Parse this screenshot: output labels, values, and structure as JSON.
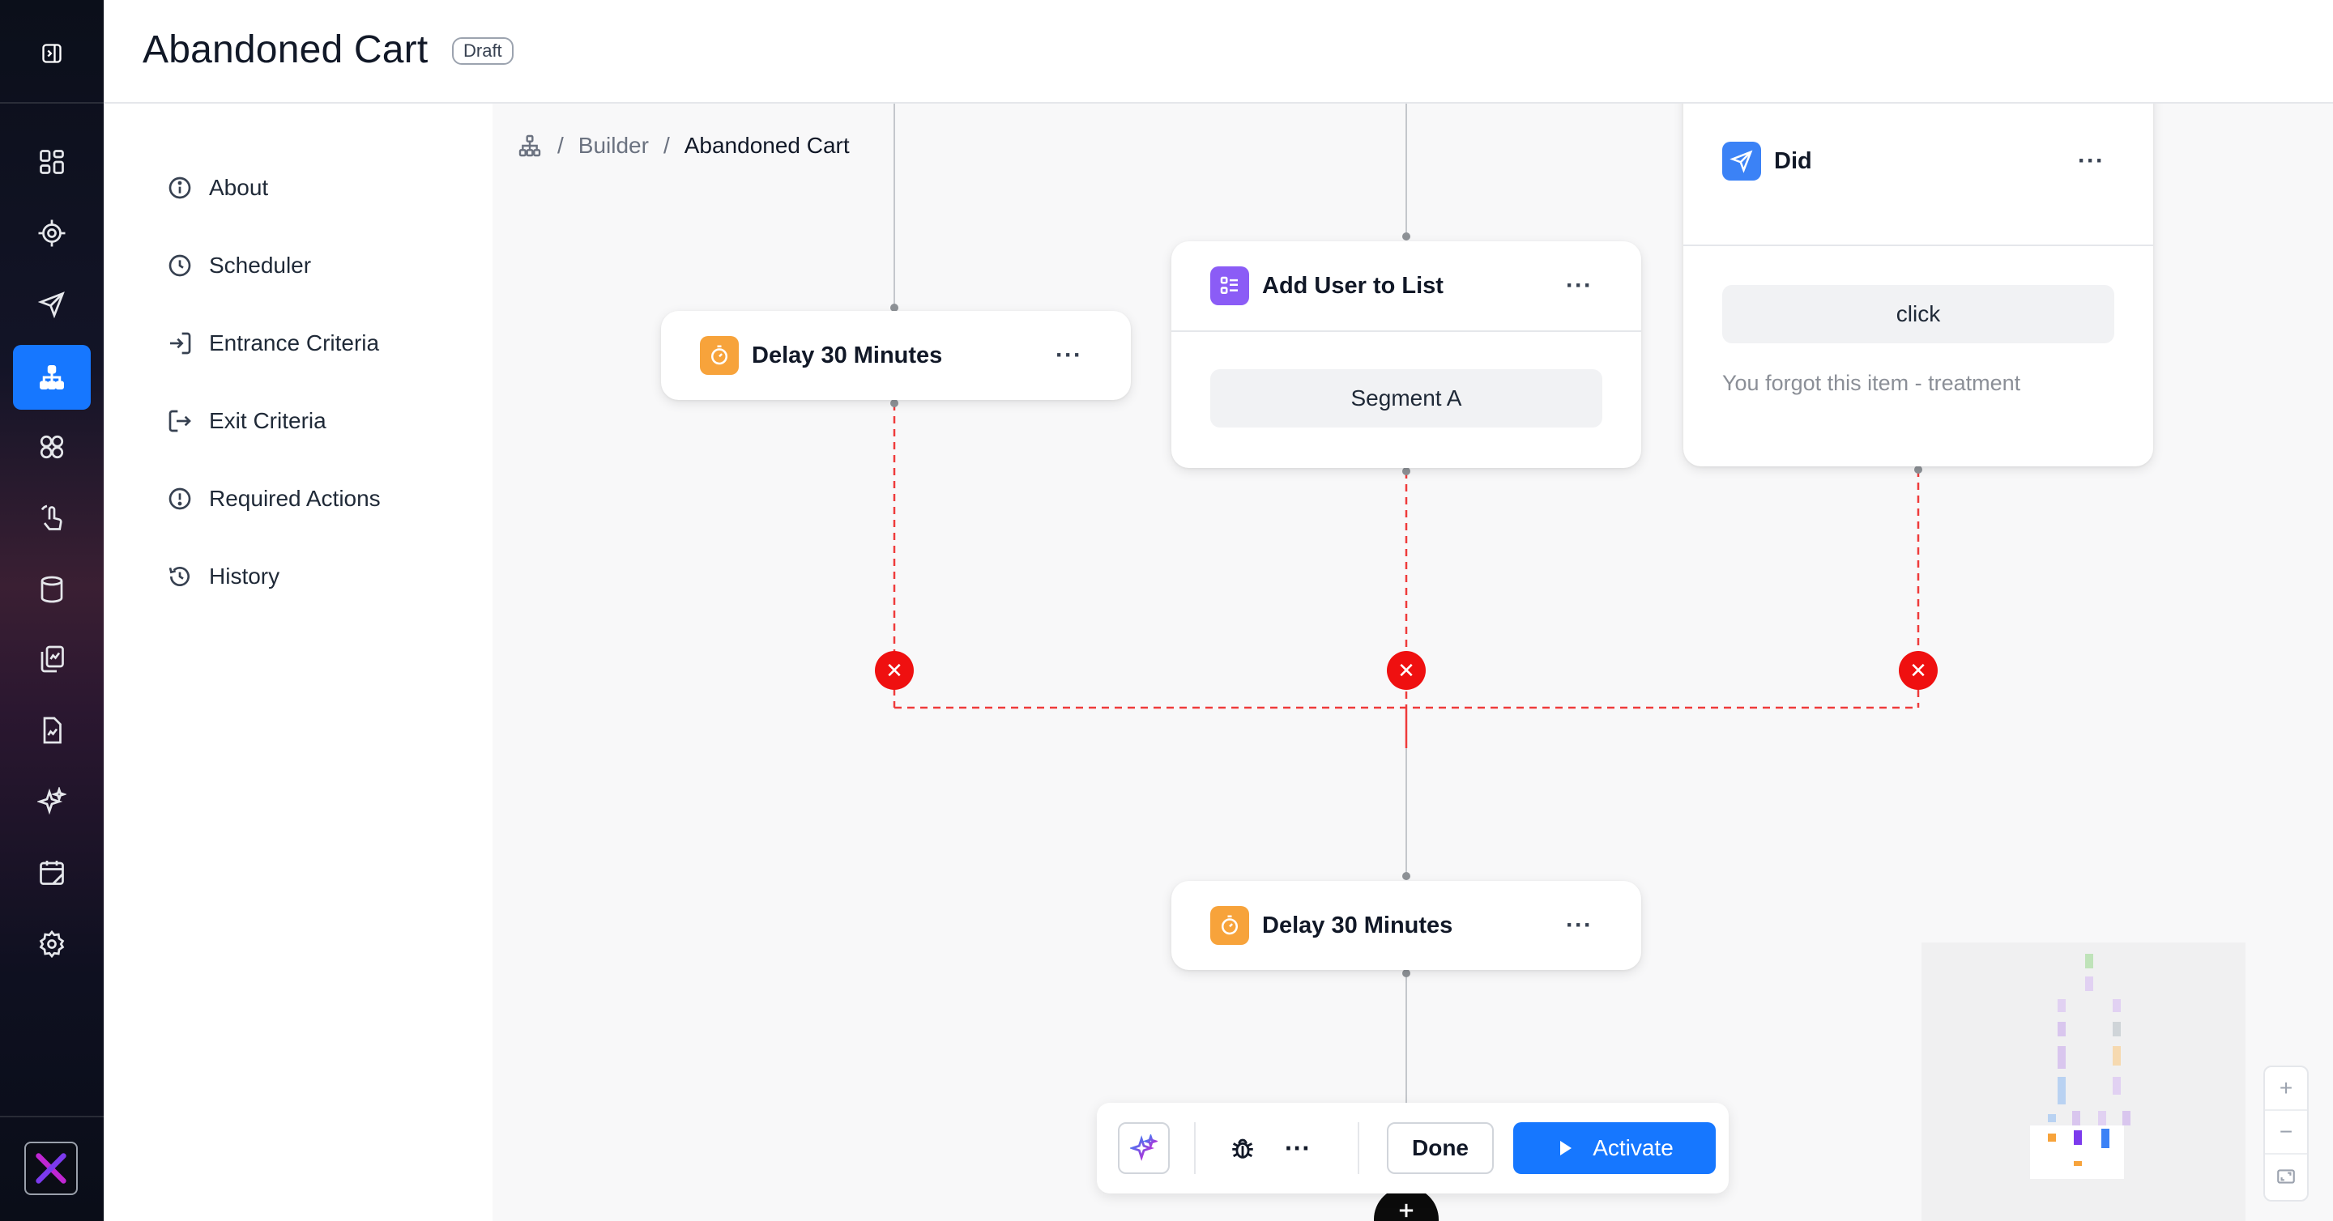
{
  "header": {
    "title": "Abandoned Cart",
    "status_badge": "Draft"
  },
  "rail": {
    "items": [
      {
        "icon": "dashboard-icon"
      },
      {
        "icon": "target-icon"
      },
      {
        "icon": "send-icon"
      },
      {
        "icon": "flow-builder-icon",
        "active": true
      },
      {
        "icon": "segments-icon"
      },
      {
        "icon": "touch-icon"
      },
      {
        "icon": "database-icon"
      },
      {
        "icon": "content-icon"
      },
      {
        "icon": "reports-icon"
      },
      {
        "icon": "ai-sparkle-icon"
      },
      {
        "icon": "calendar-icon"
      },
      {
        "icon": "settings-icon"
      }
    ]
  },
  "subnav": {
    "items": [
      {
        "label": "About",
        "icon": "info-icon"
      },
      {
        "label": "Scheduler",
        "icon": "clock-icon"
      },
      {
        "label": "Entrance Criteria",
        "icon": "enter-icon"
      },
      {
        "label": "Exit Criteria",
        "icon": "exit-icon"
      },
      {
        "label": "Required Actions",
        "icon": "alert-icon"
      },
      {
        "label": "History",
        "icon": "history-icon"
      }
    ]
  },
  "breadcrumb": {
    "items": [
      "Builder",
      "Abandoned Cart"
    ]
  },
  "nodes": {
    "delay_top": {
      "title": "Delay 30 Minutes",
      "menu": "···"
    },
    "add_user": {
      "title": "Add User to List",
      "menu": "···",
      "value": "Segment A"
    },
    "did": {
      "title": "Did",
      "menu": "···",
      "value": "click",
      "subtext": "You forgot this item - treatment"
    },
    "delay_bottom": {
      "title": "Delay 30 Minutes",
      "menu": "···"
    }
  },
  "zoom": {
    "in": "+",
    "out": "−"
  },
  "toolbar": {
    "done_label": "Done",
    "activate_label": "Activate",
    "more": "···"
  },
  "colors": {
    "accent": "#1677ff",
    "error": "#ef1010",
    "delay": "#f7a33b",
    "list": "#8b5cf6",
    "send": "#3b82f6"
  }
}
